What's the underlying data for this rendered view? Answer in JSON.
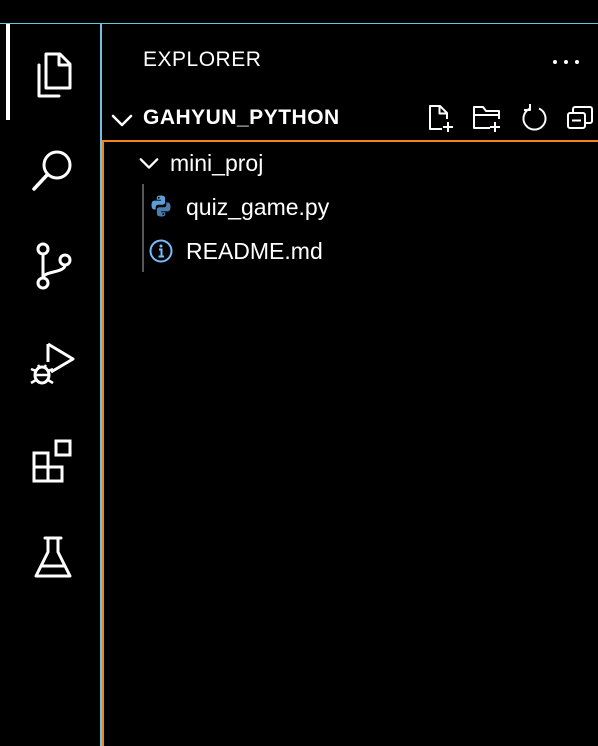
{
  "colors": {
    "background": "#000000",
    "focus_border": "#6fc3df",
    "active_outline": "#f38518",
    "foreground": "#ffffff",
    "python_icon": "#5d9ed8",
    "info_icon": "#75beff"
  },
  "activity_bar": {
    "items": [
      {
        "icon": "files-icon",
        "active": true
      },
      {
        "icon": "search-icon"
      },
      {
        "icon": "source-control-icon"
      },
      {
        "icon": "run-debug-icon"
      },
      {
        "icon": "extensions-icon"
      },
      {
        "icon": "testing-flask-icon"
      }
    ]
  },
  "explorer": {
    "title": "EXPLORER",
    "more_actions_icon": "ellipsis-icon",
    "folder": {
      "name": "GAHYUN_PYTHON",
      "actions": [
        "new-file-icon",
        "new-folder-icon",
        "refresh-icon",
        "collapse-all-icon"
      ]
    },
    "tree": [
      {
        "label": "mini_proj",
        "type": "folder",
        "expanded": true
      },
      {
        "label": "quiz_game.py",
        "type": "file",
        "icon": "python-icon"
      },
      {
        "label": "README.md",
        "type": "file",
        "icon": "info-icon"
      }
    ]
  }
}
